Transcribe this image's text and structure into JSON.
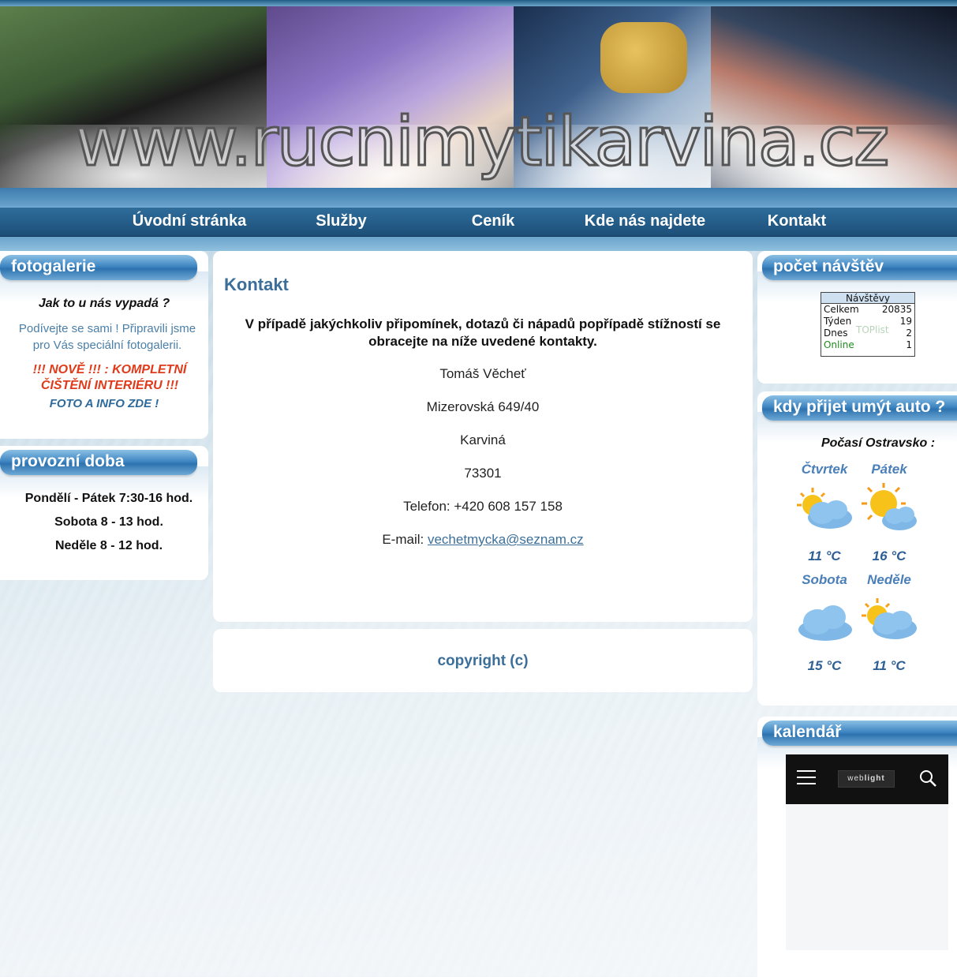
{
  "banner": {
    "title": "www.rucnimytikarvina.cz"
  },
  "nav": {
    "items": [
      "Úvodní stránka",
      "Služby",
      "Ceník",
      "Kde nás najdete",
      "Kontakt"
    ]
  },
  "fotogalerie": {
    "heading": "fotogalerie",
    "question": "Jak to u nás vypadá ?",
    "desc": "Podívejte se sami ! Připravili jsme pro Vás speciální fotogalerii.",
    "news": "!!! NOVĚ !!! : KOMPLETNÍ ČIŠTĚNÍ INTERIÉRU !!!",
    "link": "FOTO A INFO ZDE !"
  },
  "provozni": {
    "heading": "provozní doba",
    "lines": [
      "Pondělí - Pátek 7:30-16 hod.",
      "Sobota 8 - 13 hod.",
      "Neděle 8 - 12 hod."
    ]
  },
  "content": {
    "title": "Kontakt",
    "lead": "V případě jakýchkoliv připomínek, dotazů či nápadů popřípadě stížností se obracejte na níže uvedené kontakty.",
    "name": "Tomáš Věcheť",
    "street": "Mizerovská 649/40",
    "city": "Karviná",
    "zip": "73301",
    "phone": "Telefon: +420 608 157 158",
    "email_label": "E-mail: ",
    "email": "vechetmycka@seznam.cz"
  },
  "footer": {
    "copyright": "copyright (c)"
  },
  "visits": {
    "heading": "počet návštěv",
    "title": "Návštěvy",
    "rows": [
      {
        "label": "Celkem",
        "value": "20835"
      },
      {
        "label": "Týden",
        "value": "19"
      },
      {
        "label": "Dnes",
        "value": "2"
      },
      {
        "label": "Online",
        "value": "1"
      }
    ],
    "watermark": "TOPlist"
  },
  "weather": {
    "heading": "kdy přijet umýt auto ?",
    "region": "Počasí Ostravsko :",
    "days": [
      {
        "day": "Čtvrtek",
        "temp": "11 °C",
        "icon": "partly-cloudy-icon"
      },
      {
        "day": "Pátek",
        "temp": "16 °C",
        "icon": "sun-cloud-icon"
      },
      {
        "day": "Sobota",
        "temp": "15 °C",
        "icon": "cloud-icon"
      },
      {
        "day": "Neděle",
        "temp": "11 °C",
        "icon": "partly-cloudy-icon"
      }
    ]
  },
  "calendar": {
    "heading": "kalendář",
    "logo_prefix": "web",
    "logo_suffix": "light"
  },
  "colors": {
    "accent": "#3b6f9a",
    "nav": "#2f6d9c",
    "red": "#e03a1a"
  }
}
